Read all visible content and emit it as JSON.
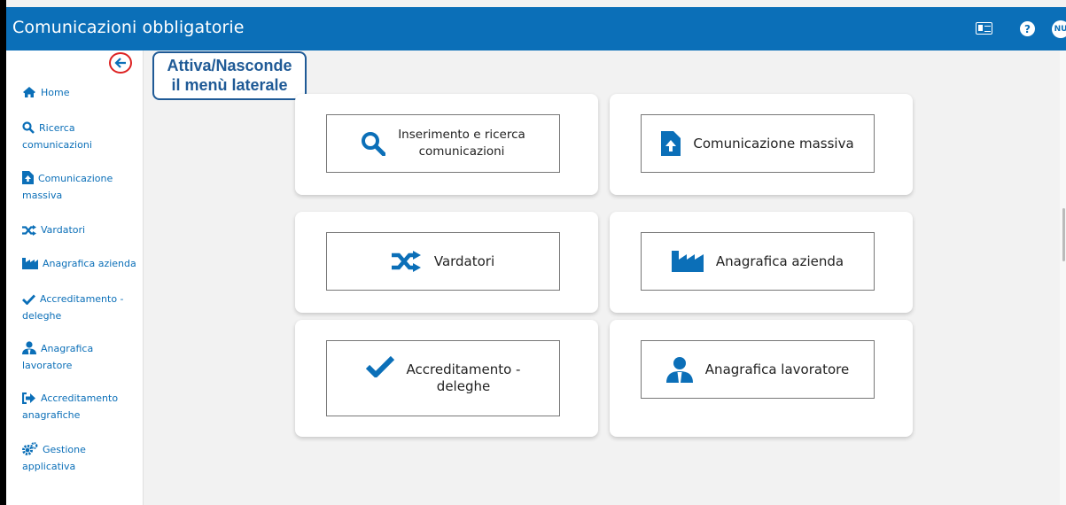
{
  "header": {
    "title": "Comunicazioni obbligatorie",
    "user_initials": "NU",
    "help_label": "?"
  },
  "callout": {
    "line1": "Attiva/Nasconde",
    "line2": "il menù laterale"
  },
  "sidebar": {
    "items": [
      {
        "label": "Home",
        "icon": "home-icon"
      },
      {
        "label1": "Ricerca",
        "label2": "comunicazioni",
        "icon": "search-icon"
      },
      {
        "label1": "Comunicazione",
        "label2": "massiva",
        "icon": "file-upload-icon"
      },
      {
        "label": "Vardatori",
        "icon": "shuffle-icon"
      },
      {
        "label": "Anagrafica azienda",
        "icon": "factory-icon"
      },
      {
        "label1": "Accreditamento -",
        "label2": "deleghe",
        "icon": "check-icon"
      },
      {
        "label1": "Anagrafica",
        "label2": "lavoratore",
        "icon": "users-icon"
      },
      {
        "label1": "Accreditamento",
        "label2": "anagrafiche",
        "icon": "sign-in-icon"
      },
      {
        "label1": "Gestione",
        "label2": "applicativa",
        "icon": "cogs-icon"
      }
    ]
  },
  "tiles": {
    "inserimento": {
      "line1": "Inserimento e ricerca",
      "line2": "comunicazioni"
    },
    "massiva": {
      "label": "Comunicazione massiva"
    },
    "vardatori": {
      "label": "Vardatori"
    },
    "azienda": {
      "label": "Anagrafica azienda"
    },
    "accreditamento": {
      "line1": "Accreditamento -",
      "line2": "deleghe"
    },
    "lavoratore": {
      "label": "Anagrafica lavoratore"
    }
  },
  "colors": {
    "brand": "#0b6fb8",
    "callout": "#1f5a96",
    "highlight": "#d22222"
  }
}
